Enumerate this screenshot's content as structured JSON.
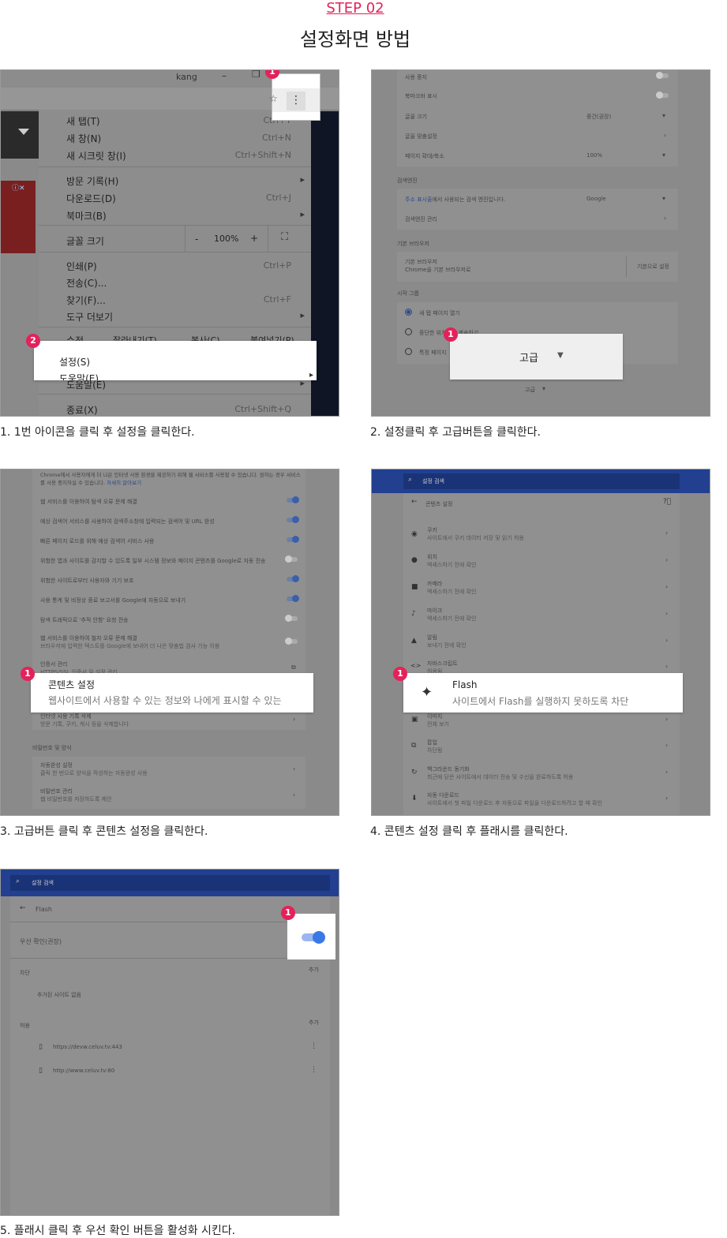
{
  "header": {
    "step": "STEP 02",
    "title": "설정화면 방법"
  },
  "panel1": {
    "caption": "1. 1번 아이콘을 클릭 후 설정을 클릭한다.",
    "user": "kang",
    "menu": [
      {
        "label": "새 탭(T)",
        "shortcut": "Ctrl+T"
      },
      {
        "label": "새 창(N)",
        "shortcut": "Ctrl+N"
      },
      {
        "label": "새 시크릿 창(I)",
        "shortcut": "Ctrl+Shift+N"
      },
      {
        "label": "방문 기록(H)",
        "shortcut": "▸"
      },
      {
        "label": "다운로드(D)",
        "shortcut": "Ctrl+J"
      },
      {
        "label": "북마크(B)",
        "shortcut": "▸"
      },
      {
        "label": "글꼴 크기",
        "shortcut": ""
      },
      {
        "label": "인쇄(P)",
        "shortcut": "Ctrl+P"
      },
      {
        "label": "전송(C)...",
        "shortcut": ""
      },
      {
        "label": "찾기(F)...",
        "shortcut": "Ctrl+F"
      },
      {
        "label": "도구 더보기",
        "shortcut": "▸"
      },
      {
        "label": "수정",
        "shortcut": ""
      },
      {
        "label": "도움말(E)",
        "shortcut": "▸"
      },
      {
        "label": "종료(X)",
        "shortcut": "Ctrl+Shift+Q"
      }
    ],
    "zoom": {
      "minus": "-",
      "value": "100%",
      "plus": "+"
    },
    "edit": {
      "cut": "잘라내기(T)",
      "copy": "복사(C)",
      "paste": "붙여넣기(P)"
    },
    "highlight": {
      "settings": "설정(S)",
      "help": "도움말(E)"
    },
    "badges": [
      "1",
      "2"
    ]
  },
  "panel2": {
    "caption": "2. 설정클릭 후 고급버튼을 클릭한다.",
    "rows": [
      {
        "label": "사용 중지",
        "value": ""
      },
      {
        "label": "북마크바 표시",
        "value": ""
      },
      {
        "label": "글꼴 크기",
        "value": "중간(권장)"
      },
      {
        "label": "글꼴 맞춤설정",
        "value": ""
      },
      {
        "label": "페이지 확대/축소",
        "value": "100%"
      }
    ],
    "search_engine_heading": "검색엔진",
    "search_engine_row": {
      "link": "주소 표시줄",
      "rest": "에서 사용되는 검색 엔진입니다.",
      "value": "Google"
    },
    "search_engine_manage": "검색엔진 관리",
    "default_browser_heading": "기본 브라우저",
    "default_browser": {
      "title": "기본 브라우저",
      "sub": "Chrome을 기본 브라우저로",
      "button": "기본으로 설정"
    },
    "startup_heading": "시작 그룹",
    "startup_options": [
      "새 탭 페이지 열기",
      "중단한 위치에서 계속하기",
      "특정 페이지"
    ],
    "advanced_label": "고급",
    "advanced_small": "고급",
    "badge": "1"
  },
  "panel3": {
    "caption": "3. 고급버튼 클릭 후 콘텐츠 설정을 클릭한다.",
    "intro": "Chrome에서 사용자에게 더 나은 인터넷 사용 환경을 제공하기 위해 웹 서비스를 사용할 수 있습니다. 원하는 경우 서비스를 사용 중지하실 수 있습니다.",
    "intro_link": "자세히 알아보기",
    "toggles": [
      {
        "label": "웹 서비스를 이용하여 탐색 오류 문제 해결",
        "on": true
      },
      {
        "label": "예상 검색어 서비스를 사용하여 검색주소창에 입력되는 검색어 및 URL 완성",
        "on": true
      },
      {
        "label": "빠른 페이지 로드를 위해 예상 검색어 서비스 사용",
        "on": true
      },
      {
        "label": "위험한 앱과 사이트를 감지할 수 있도록 일부 시스템 정보와 페이지 콘텐츠를 Google로 자동 전송",
        "on": false
      },
      {
        "label": "위험한 사이트로부터 사용자와 기기 보호",
        "on": true
      },
      {
        "label": "사용 통계 및 비정상 종료 보고서를 Google에 자동으로 보내기",
        "on": true
      },
      {
        "label": "탐색 트래픽으로 '추적 안함' 요청 전송",
        "on": false
      }
    ],
    "spell": {
      "title": "웹 서비스를 이용하여 철자 오류 문제 해결",
      "sub": "브라우저에 입력한 텍스트를 Google에 보내어 더 나은 맞춤법 검사 기능 이용"
    },
    "cert": {
      "title": "인증서 관리",
      "sub": "HTTPS/SSL 인증서 및 설정 관리"
    },
    "highlight": {
      "title": "콘텐츠 설정",
      "sub": "웹사이트에서 사용할 수 있는 정보와 나에게 표시할 수 있는"
    },
    "history": {
      "title": "인터넷 사용 기록 삭제",
      "sub": "방문 기록, 쿠키, 캐시 등을 삭제합니다"
    },
    "pw_heading": "비밀번호 및 양식",
    "autofill": {
      "title": "자동완성 설정",
      "sub": "클릭 한 번으로 양식을 작성하는 자동완성 사용"
    },
    "pwmgr": {
      "title": "비밀번호 관리",
      "sub": "웹 비밀번호를 저장하도록 제안"
    },
    "badge": "1"
  },
  "panel4": {
    "caption": "4. 콘텐츠 설정 클릭 후 플래시를 클릭한다.",
    "search_placeholder": "설정 검색",
    "back_title": "콘텐츠 설정",
    "items": [
      {
        "icon": "cookie-icon",
        "title": "쿠키",
        "sub": "사이트에서 쿠키 데이터 저장 및 읽기 허용"
      },
      {
        "icon": "location-icon",
        "title": "위치",
        "sub": "액세스하기 전에 확인"
      },
      {
        "icon": "camera-icon",
        "title": "카메라",
        "sub": "액세스하기 전에 확인"
      },
      {
        "icon": "mic-icon",
        "title": "마이크",
        "sub": "액세스하기 전에 확인"
      },
      {
        "icon": "bell-icon",
        "title": "알림",
        "sub": "보내기 전에 확인"
      },
      {
        "icon": "code-icon",
        "title": "자바스크립트",
        "sub": "허용됨"
      }
    ],
    "items_after": [
      {
        "icon": "image-icon",
        "title": "이미지",
        "sub": "전체 보기"
      },
      {
        "icon": "popup-icon",
        "title": "팝업",
        "sub": "차단됨"
      },
      {
        "icon": "sync-icon",
        "title": "백그라운드 동기화",
        "sub": "최근에 닫은 사이트에서 데이터 전송 및 수신을 완료하도록 허용"
      },
      {
        "icon": "download-icon",
        "title": "자동 다운로드",
        "sub": "사이트에서 첫 파일 다운로드 후 자동으로 파일을 다운로드하려고 할 때 확인"
      }
    ],
    "highlight": {
      "title": "Flash",
      "sub": "사이트에서 Flash를 실행하지 못하도록 차단"
    },
    "badge": "1"
  },
  "panel5": {
    "caption": "5. 플래시 클릭 후 우선 확인 버튼을 활성화 시킨다.",
    "search_placeholder": "설정 검색",
    "back_title": "Flash",
    "ask_first": "우선 확인(권장)",
    "block_label": "차단",
    "add1": "추가",
    "no_sites": "추가된 사이트 없음",
    "allow_label": "허용",
    "add2": "추가",
    "sites": [
      "https://devw.celuv.tv:443",
      "http://www.celuv.tv:80"
    ],
    "badge": "1"
  }
}
